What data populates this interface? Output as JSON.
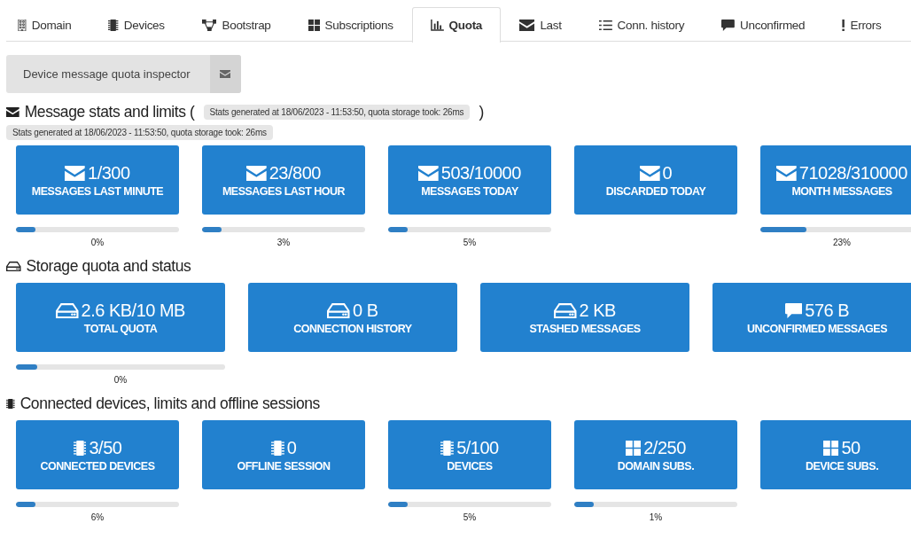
{
  "tabs": [
    {
      "label": "Domain",
      "selected": false
    },
    {
      "label": "Devices",
      "selected": false
    },
    {
      "label": "Bootstrap",
      "selected": false
    },
    {
      "label": "Subscriptions",
      "selected": false
    },
    {
      "label": "Quota",
      "selected": true
    },
    {
      "label": "Last",
      "selected": false
    },
    {
      "label": "Conn. history",
      "selected": false
    },
    {
      "label": "Unconfirmed",
      "selected": false
    },
    {
      "label": "Errors",
      "selected": false
    }
  ],
  "inspector_button": {
    "label": "Device message quota inspector"
  },
  "sections": [
    {
      "kind": "messages",
      "title": "Message stats and limits (",
      "title_end": ")",
      "inline_badge": "Stats generated at 18/06/2023 - 11:53:50, quota storage took: 26ms",
      "badge": "Stats generated at 18/06/2023 - 11:53:50, quota storage took: 26ms",
      "tiles": [
        {
          "kind": "messages",
          "value": "1/300",
          "label": "MESSAGES LAST MINUTE",
          "level": 0.12,
          "percent": "0%"
        },
        {
          "kind": "messages",
          "value": "23/800",
          "label": "MESSAGES LAST HOUR",
          "level": 0.12,
          "percent": "3%"
        },
        {
          "kind": "messages",
          "value": "503/10000",
          "label": "MESSAGES TODAY",
          "level": 0.12,
          "percent": "5%"
        },
        {
          "kind": "messages",
          "value": "0",
          "label": "DISCARDED TODAY"
        },
        {
          "kind": "messages",
          "value": "71028/310000",
          "label": "MONTH MESSAGES",
          "level": 0.28,
          "percent": "23%"
        }
      ]
    },
    {
      "kind": "storage",
      "title": "Storage quota and status",
      "tiles": [
        {
          "kind": "storage",
          "value": "2.6 KB/10 MB",
          "label": "TOTAL QUOTA",
          "level": 0.1,
          "percent": "0%"
        },
        {
          "kind": "storage",
          "value": "0 B",
          "label": "CONNECTION HISTORY"
        },
        {
          "kind": "storage",
          "value": "2 KB",
          "label": "STASHED MESSAGES"
        },
        {
          "kind": "unconfirmed",
          "value": "576 B",
          "label": "UNCONFIRMED MESSAGES"
        }
      ]
    },
    {
      "kind": "devices",
      "title": "Connected devices, limits and offline sessions",
      "tiles": [
        {
          "kind": "devices",
          "value": "3/50",
          "label": "CONNECTED DEVICES",
          "level": 0.12,
          "percent": "6%"
        },
        {
          "kind": "devices",
          "value": "0",
          "label": "OFFLINE SESSION"
        },
        {
          "kind": "devices",
          "value": "5/100",
          "label": "DEVICES",
          "level": 0.12,
          "percent": "5%"
        },
        {
          "kind": "subscriptions",
          "value": "2/250",
          "label": "DOMAIN SUBS.",
          "level": 0.12,
          "percent": "1%"
        },
        {
          "kind": "subscriptions",
          "value": "50",
          "label": "DEVICE SUBS."
        }
      ]
    }
  ]
}
